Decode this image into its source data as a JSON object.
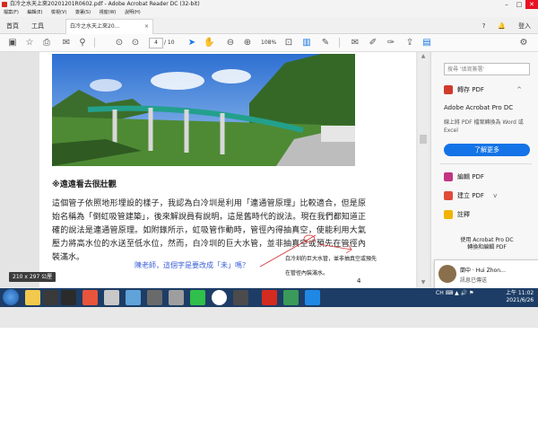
{
  "window": {
    "title": "白冷之水天上來20201201R0602.pdf - Adobe Acrobat Reader DC (32-bit)",
    "controls": [
      "–",
      "□",
      "✕"
    ]
  },
  "menu": [
    "檔案(F)",
    "編輯(E)",
    "檢視(V)",
    "簽署(S)",
    "視窗(W)",
    "說明(H)"
  ],
  "tabs": {
    "home": "首頁",
    "tools": "工具",
    "document": "白冷之水天上來20…"
  },
  "topright": {
    "help": "?",
    "bell": "🔔",
    "login": "登入"
  },
  "toolbar": {
    "page_current": "4",
    "page_total": "/ 10",
    "zoom": "108%"
  },
  "document": {
    "caption": "※遠遠看去很壯觀",
    "paragraph": "這個管子依照地形埋設的樣子，我認為白冷圳是利用「連通管原理」比較適合，但是原始名稱為「倒虹吸管建築」，後來解說員有說明，這是舊時代的說法。現在我們都知道正確的說法是連通管原理。如附錄所示，虹吸管作動時，管徑內得抽真空，使能利用大氣壓力將高水位的水送至低水位，然而，白冷圳的巨大水管，並非抽真空或預先在管徑內裝滿水。",
    "size_indicator": "210 x 297 公厘",
    "comment": "陳老師，這個字是要改成「未」嗎？",
    "note_line1": "白冷圳的巨大水管，並非抽真空或預先",
    "note_line2": "在管徑內裝滿水。",
    "page_number": "4"
  },
  "right_panel": {
    "search_placeholder": "搜尋 '填寫簽署'",
    "export_label": "轉存 PDF",
    "pro_title": "Adobe Acrobat Pro DC",
    "pro_desc": "線上將 PDF 檔案轉換為 Word 或 Excel",
    "learn_more": "了解更多",
    "edit_label": "編輯 PDF",
    "create_label": "建立 PDF",
    "comment_label": "註釋",
    "promo_line1": "使用 Acrobat Pro DC",
    "promo_line2": "轉換和編輯 PDF",
    "promo_line3": "",
    "accent": "#1473e6"
  },
  "notification": {
    "name": "蘭中 · Hui Zhon…",
    "message": "訊息已傳送"
  },
  "taskbar": {
    "tray": "CH ⌨ ▲ 🔊 ⚑",
    "time": "上午 11:02",
    "date": "2021/6/26"
  }
}
